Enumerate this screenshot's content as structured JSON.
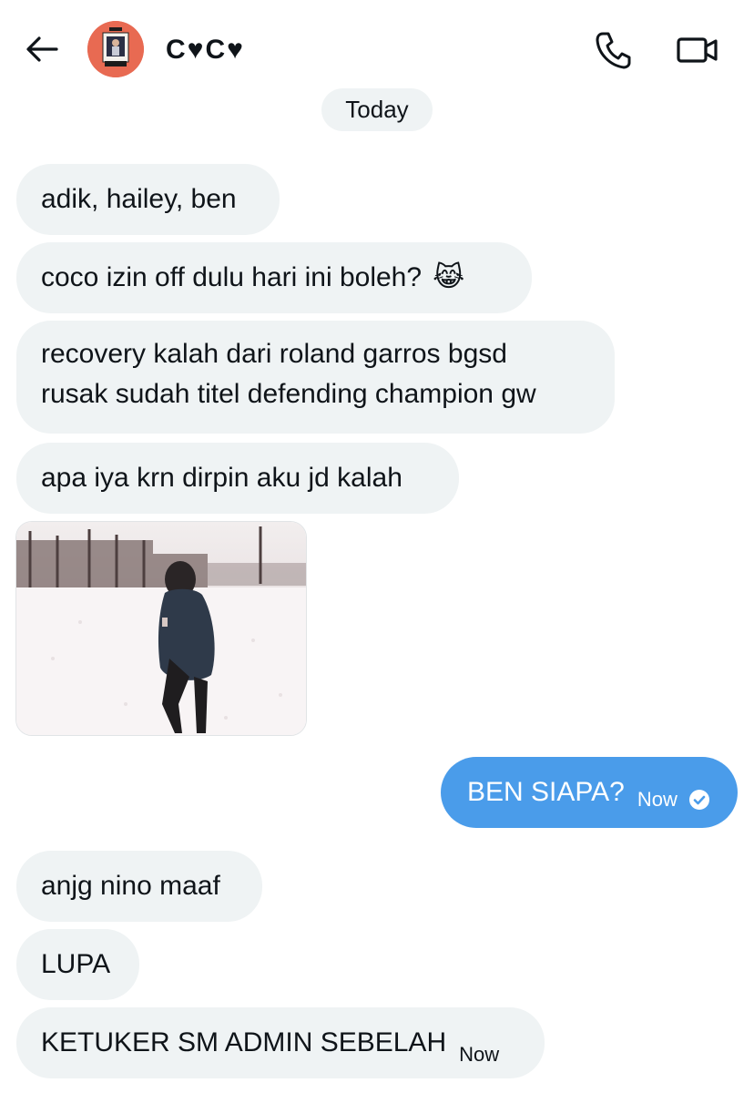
{
  "header": {
    "contact_name": "C♥C♥",
    "icons": {
      "back": "arrow-left-icon",
      "call": "phone-icon",
      "video": "video-camera-icon"
    }
  },
  "date_separator": "Today",
  "messages": [
    {
      "text": "adik, hailey, ben"
    },
    {
      "text": "coco izin off dulu hari ini boleh?",
      "emoji": "😹"
    },
    {
      "lines": [
        "recovery kalah dari roland garros bgsd",
        "rusak sudah titel defending champion gw"
      ]
    },
    {
      "text": "apa iya krn dirpin aku jd kalah"
    },
    {
      "gif": "person walking in snowy field"
    },
    {
      "sent_text": "BEN SIAPA?",
      "time": "Now",
      "status_icon": "check-circle-icon"
    },
    {
      "text": "anjg nino maaf"
    },
    {
      "text": "LUPA"
    },
    {
      "text": "KETUKER SM ADMIN SEBELAH",
      "time": "Now"
    }
  ],
  "colors": {
    "received_bubble": "#eff3f4",
    "sent_bubble": "#4a9cea",
    "text": "#0f1419"
  }
}
